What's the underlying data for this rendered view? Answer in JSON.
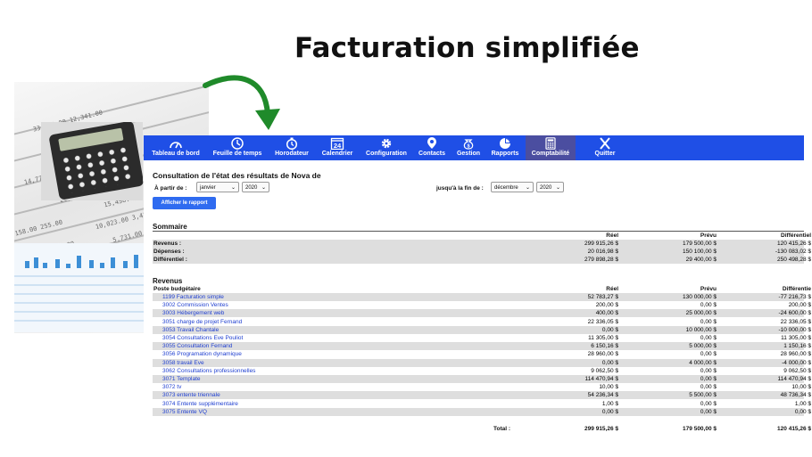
{
  "headline": "Facturation simplifiée",
  "nav": [
    {
      "label": "Tableau de bord",
      "icon": "gauge-icon"
    },
    {
      "label": "Feuille de temps",
      "icon": "clock-icon"
    },
    {
      "label": "Horodateur",
      "icon": "stopwatch-icon"
    },
    {
      "label": "Calendrier",
      "icon": "calendar-icon",
      "day": "24"
    },
    {
      "label": "Configuration",
      "icon": "gear-icon"
    },
    {
      "label": "Contacts",
      "icon": "contact-pin-icon"
    },
    {
      "label": "Gestion",
      "icon": "money-bag-icon"
    },
    {
      "label": "Rapports",
      "icon": "pie-chart-icon"
    },
    {
      "label": "Comptabilité",
      "icon": "calculator-icon",
      "active": true
    },
    {
      "label": "Quitter",
      "icon": "close-icon"
    }
  ],
  "report": {
    "title": "Consultation de l'état des résultats de Nova de",
    "from_label": "À partir de :",
    "from_month": "janvier",
    "from_year": "2020",
    "to_label": "jusqu'à la fin de :",
    "to_month": "décembre",
    "to_year": "2020",
    "show_button": "Afficher le rapport"
  },
  "summary": {
    "heading": "Sommaire",
    "col_reel": "Réel",
    "col_prevu": "Prévu",
    "col_diff": "Différentiel",
    "rows": [
      {
        "label": "Revenus :",
        "reel": "299 915,26 $",
        "prevu": "179 500,00 $",
        "diff": "120 415,26 $"
      },
      {
        "label": "Dépenses :",
        "reel": "20 016,98 $",
        "prevu": "150 100,00 $",
        "diff": "-130 083,02 $"
      },
      {
        "label": "Différentiel :",
        "reel": "279 898,28 $",
        "prevu": "29 400,00 $",
        "diff": "250 498,28 $"
      }
    ]
  },
  "revenus": {
    "heading": "Revenus",
    "col_poste": "Poste budgétaire",
    "col_reel": "Réel",
    "col_prevu": "Prévu",
    "col_diff": "Différentie",
    "rows": [
      {
        "label": "1199 Facturation simple",
        "reel": "52 783,27 $",
        "prevu": "130 000,00 $",
        "diff": "-77 216,73 $"
      },
      {
        "label": "3002 Commission Ventes",
        "reel": "200,00 $",
        "prevu": "0,00 $",
        "diff": "200,00 $"
      },
      {
        "label": "3003 Hébergement web",
        "reel": "400,00 $",
        "prevu": "25 000,00 $",
        "diff": "-24 600,00 $"
      },
      {
        "label": "3051 charge de projet Fernand",
        "reel": "22 336,05 $",
        "prevu": "0,00 $",
        "diff": "22 336,05 $"
      },
      {
        "label": "3053 Travail Chantale",
        "reel": "0,00 $",
        "prevu": "10 000,00 $",
        "diff": "-10 000,00 $"
      },
      {
        "label": "3054 Consultations Eve Pouliot",
        "reel": "11 305,00 $",
        "prevu": "0,00 $",
        "diff": "11 305,00 $"
      },
      {
        "label": "3055 Consultation Fernand",
        "reel": "6 150,16 $",
        "prevu": "5 000,00 $",
        "diff": "1 150,16 $"
      },
      {
        "label": "3056 Programation dynamique",
        "reel": "28 960,00 $",
        "prevu": "0,00 $",
        "diff": "28 960,00 $"
      },
      {
        "label": "3058 travail Eve",
        "reel": "0,00 $",
        "prevu": "4 000,00 $",
        "diff": "-4 000,00 $"
      },
      {
        "label": "3062 Consultations professionnelles",
        "reel": "9 062,50 $",
        "prevu": "0,00 $",
        "diff": "9 062,50 $"
      },
      {
        "label": "3071 Template",
        "reel": "114 470,94 $",
        "prevu": "0,00 $",
        "diff": "114 470,94 $"
      },
      {
        "label": "3072 tv",
        "reel": "10,00 $",
        "prevu": "0,00 $",
        "diff": "10,00 $"
      },
      {
        "label": "3073 entente triennale",
        "reel": "54 236,34 $",
        "prevu": "5 500,00 $",
        "diff": "48 736,34 $"
      },
      {
        "label": "3074 Entente supplémentaire",
        "reel": "1,00 $",
        "prevu": "0,00 $",
        "diff": "1,00 $"
      },
      {
        "label": "3075 Entente VQ",
        "reel": "0,00 $",
        "prevu": "0,00 $",
        "diff": "0,00 $"
      }
    ],
    "total_label": "Total :",
    "total_reel": "299 915,26 $",
    "total_prevu": "179 500,00 $",
    "total_diff": "120 415,26 $"
  },
  "colors": {
    "nav_bg": "#1f4fe6",
    "nav_active": "#4b4ea0",
    "link": "#1f3fd0",
    "arrow": "#1f8a2a",
    "button": "#2f6bf0"
  }
}
